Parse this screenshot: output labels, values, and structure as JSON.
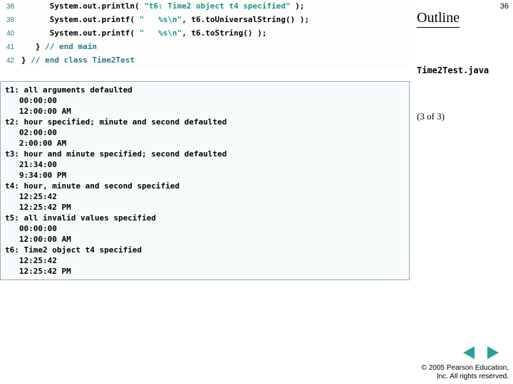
{
  "page_number": "36",
  "sidebar": {
    "outline": "Outline",
    "filename": "Time2Test.java",
    "page_of": "(3 of 3)"
  },
  "code": {
    "lines": [
      {
        "no": "38",
        "pre": "      System.out.println( ",
        "str": "\"t6: Time2 object t4 specified\"",
        "post": " );"
      },
      {
        "no": "39",
        "pre": "      System.out.printf( ",
        "str": "\"   %s\\n\"",
        "post": ", t6.toUniversalString() );"
      },
      {
        "no": "40",
        "pre": "      System.out.printf( ",
        "str": "\"   %s\\n\"",
        "post": ", t6.toString() );"
      },
      {
        "no": "41",
        "pre": "   } ",
        "comment": "// end main"
      },
      {
        "no": "42",
        "pre": "} ",
        "comment": "// end class Time2Test"
      }
    ]
  },
  "output": [
    "t1: all arguments defaulted",
    "   00:00:00",
    "   12:00:00 AM",
    "t2: hour specified; minute and second defaulted",
    "   02:00:00",
    "   2:00:00 AM",
    "t3: hour and minute specified; second defaulted",
    "   21:34:00",
    "   9:34:00 PM",
    "t4: hour, minute and second specified",
    "   12:25:42",
    "   12:25:42 PM",
    "t5: all invalid values specified",
    "   00:00:00",
    "   12:00:00 AM",
    "t6: Time2 object t4 specified",
    "   12:25:42",
    "   12:25:42 PM"
  ],
  "footer": {
    "line1": "© 2005 Pearson Education,",
    "line2": "Inc.  All rights reserved."
  }
}
